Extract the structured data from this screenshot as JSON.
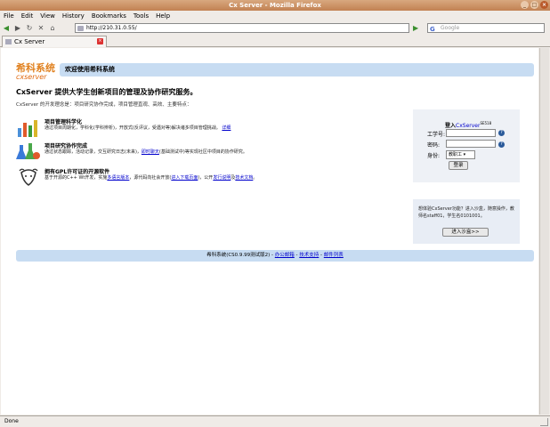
{
  "window": {
    "title": "Cx Server - Mozilla Firefox"
  },
  "menu": [
    "File",
    "Edit",
    "View",
    "History",
    "Bookmarks",
    "Tools",
    "Help"
  ],
  "nav": {
    "url": "http://210.31.0.55/",
    "search_placeholder": "Google"
  },
  "tab": {
    "label": "Cx Server"
  },
  "page": {
    "logo_cn": "希科系统",
    "logo_en": "cxserver",
    "banner": "欢迎使用希科系统",
    "headline": "CxServer 提供大学生创新项目的管理及协作研究服务。",
    "intro": "CxServer 的开发理念是：项目研究协作完成，项目管理直观、高效、主要特点：",
    "features": [
      {
        "title": "项目管理科学化",
        "desc": "通过项目周期化，学科化(学科辨析)，开放式(反评议，受遇对等)解决诸多项目管理挑战。",
        "link": "详细"
      },
      {
        "title": "项目研究协作完成",
        "desc_pre": "通过状态跟踪，活动记录，交互研究日志(未来)，",
        "link": "即时聊天",
        "desc_post": "(基础测试中)等实现社区中项目的协作研究。"
      },
      {
        "title": "拥有GPL许可证的开源软件",
        "desc_pre": "基于开源的C++ Wt开发，实施",
        "link1": "多语言版本",
        "desc_mid": "，源代码向社会开放(",
        "link2": "进入下载页面",
        "desc_mid2": ")，公开",
        "link3": "发行说明",
        "desc_and": "及",
        "link4": "技术文档",
        "desc_end": "。"
      }
    ],
    "login": {
      "title_pre": "登入",
      "title_brand": "CxServer",
      "title_sup": "SE518",
      "id_label": "工学号:",
      "pw_label": "密码:",
      "role_label": "身份:",
      "role_value": "教职工",
      "submit": "登录"
    },
    "try": {
      "text": "想体验CxServer功能？进入沙盒，随意操作，教师名staff01，学生名0101001。",
      "button": "进入沙盒>>"
    },
    "footer": {
      "prefix": "希科系统(CS0.9.99测试版2) -",
      "link1": "办公邮箱",
      "sep": " - ",
      "link2": "技术支持",
      "link3": "邮件列表"
    }
  },
  "status": "Done",
  "colors": {
    "banner": "#c7dcf2",
    "logo": "#e0801e",
    "titlebar": "#c28152"
  }
}
